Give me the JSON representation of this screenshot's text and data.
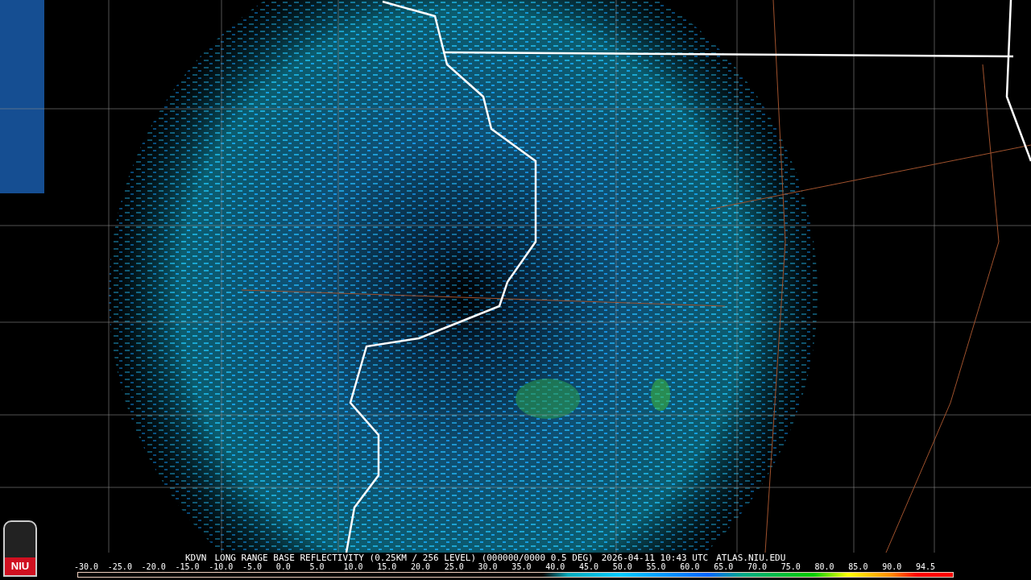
{
  "logo": {
    "text": "NIU"
  },
  "caption": {
    "station": "KDVN",
    "product": "LONG RANGE BASE REFLECTIVITY (0.25KM / 256 LEVEL) (000000/0000 0.5 DEG)",
    "time": "2026-04-11 10:43 UTC",
    "source": "ATLAS.NIU.EDU"
  },
  "scale": {
    "labels": [
      "-30.0",
      "-25.0",
      "-20.0",
      "-15.0",
      "-10.0",
      "-5.0",
      "0.0",
      "5.0",
      "10.0",
      "15.0",
      "20.0",
      "25.0",
      "30.0",
      "35.0",
      "40.0",
      "45.0",
      "50.0",
      "55.0",
      "60.0",
      "65.0",
      "70.0",
      "75.0",
      "80.0",
      "85.0",
      "90.0",
      "94.5"
    ]
  }
}
